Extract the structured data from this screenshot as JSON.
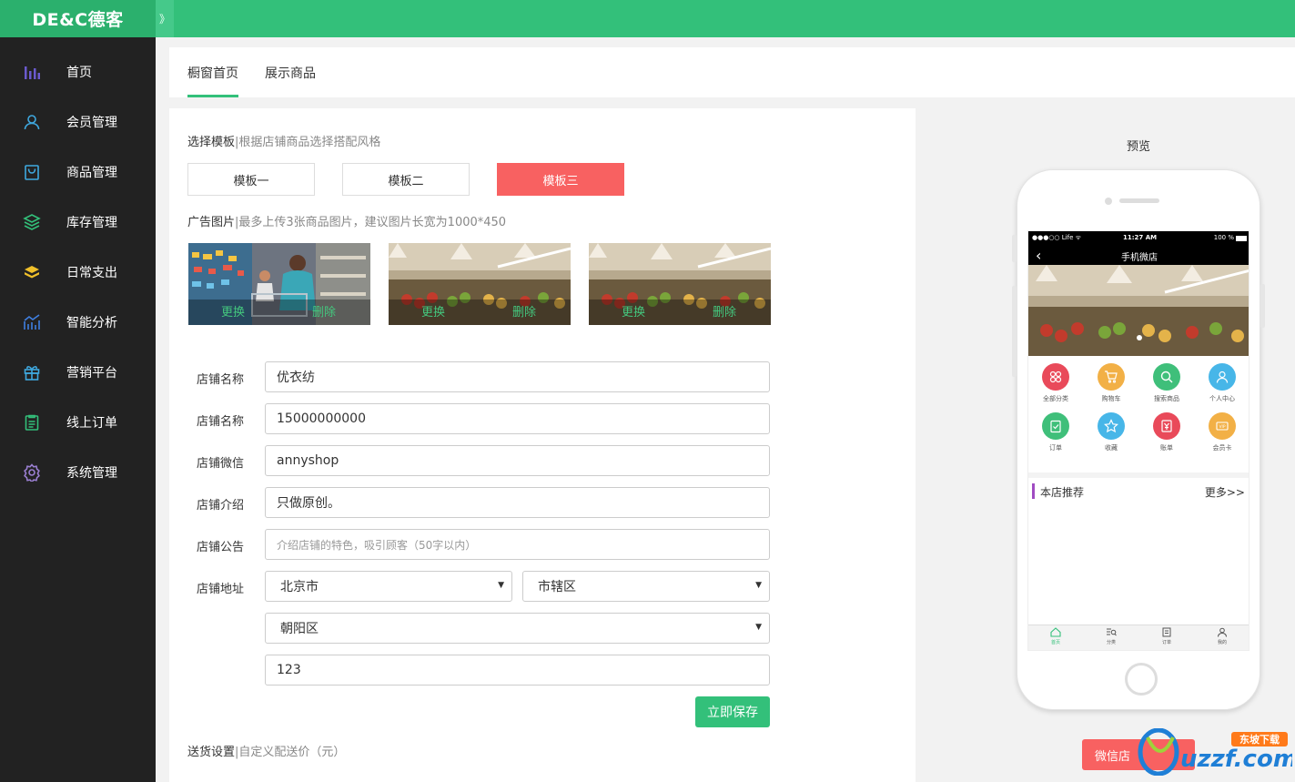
{
  "app": {
    "logo": "DE&C德客",
    "collapse_glyph": "》"
  },
  "sidebar": {
    "items": [
      {
        "label": "首页",
        "icon": "bar-chart-icon",
        "color": "#6a5acd"
      },
      {
        "label": "会员管理",
        "icon": "user-icon",
        "color": "#3fa9e0"
      },
      {
        "label": "商品管理",
        "icon": "bag-icon",
        "color": "#3fa9e0"
      },
      {
        "label": "库存管理",
        "icon": "layers-icon",
        "color": "#33c07a"
      },
      {
        "label": "日常支出",
        "icon": "stack-icon",
        "color": "#f0c02a"
      },
      {
        "label": "智能分析",
        "icon": "trend-chart-icon",
        "color": "#3f7fe0"
      },
      {
        "label": "营销平台",
        "icon": "gift-icon",
        "color": "#3fa9e0"
      },
      {
        "label": "线上订单",
        "icon": "clipboard-icon",
        "color": "#33c07a"
      },
      {
        "label": "系统管理",
        "icon": "gear-icon",
        "color": "#9a7fd1"
      }
    ]
  },
  "tabs": [
    {
      "label": "橱窗首页",
      "active": true
    },
    {
      "label": "展示商品",
      "active": false
    }
  ],
  "template_section": {
    "title": "选择模板",
    "subtitle": "|根据店铺商品选择搭配风格",
    "buttons": [
      "模板一",
      "模板二",
      "模板三"
    ],
    "selected": "模板三"
  },
  "ad_section": {
    "title": "广告图片",
    "subtitle": "|最多上传3张商品图片，建议图片长宽为1000*450",
    "images": [
      {
        "replace": "更换",
        "delete": "删除"
      },
      {
        "replace": "更换",
        "delete": "删除"
      },
      {
        "replace": "更换",
        "delete": "删除"
      }
    ]
  },
  "form": {
    "shop_name_label": "店铺名称",
    "shop_name_value": "优衣纺",
    "shop_phone_label": "店铺名称",
    "shop_phone_value": "15000000000",
    "shop_wechat_label": "店铺微信",
    "shop_wechat_value": "annyshop",
    "shop_intro_label": "店铺介绍",
    "shop_intro_value": "只做原创。",
    "shop_notice_label": "店铺公告",
    "shop_notice_placeholder": "介绍店铺的特色，吸引顾客（50字以内）",
    "shop_address_label": "店铺地址",
    "province": "北京市",
    "city": "市辖区",
    "district": "朝阳区",
    "address_detail": "123",
    "select_arrow": "▼",
    "save_label": "立即保存"
  },
  "delivery_section": {
    "title": "送货设置",
    "subtitle": "|自定义配送价（元）"
  },
  "preview": {
    "label": "预览",
    "status_left": "●●●○○ Life ᯤ",
    "status_time": "11:27 AM",
    "status_right": "100 %",
    "nav_title": "手机微店",
    "back_glyph": "‹",
    "menu": [
      {
        "label": "全部分类",
        "color": "#e94a5a"
      },
      {
        "label": "购物车",
        "color": "#f2b046"
      },
      {
        "label": "搜索商品",
        "color": "#3fbf7a"
      },
      {
        "label": "个人中心",
        "color": "#47b6e8"
      },
      {
        "label": "订单",
        "color": "#3fbf7a"
      },
      {
        "label": "收藏",
        "color": "#47b6e8"
      },
      {
        "label": "账单",
        "color": "#e94a5a"
      },
      {
        "label": "会员卡",
        "color": "#f2b046"
      }
    ],
    "recommend_title": "本店推荐",
    "recommend_more": "更多>>",
    "tabbar": [
      "首页",
      "分类",
      "订单",
      "我的"
    ]
  },
  "wechat_button": "微信店",
  "watermark": {
    "brand": "uzzf.com",
    "badge": "东坡下载"
  }
}
